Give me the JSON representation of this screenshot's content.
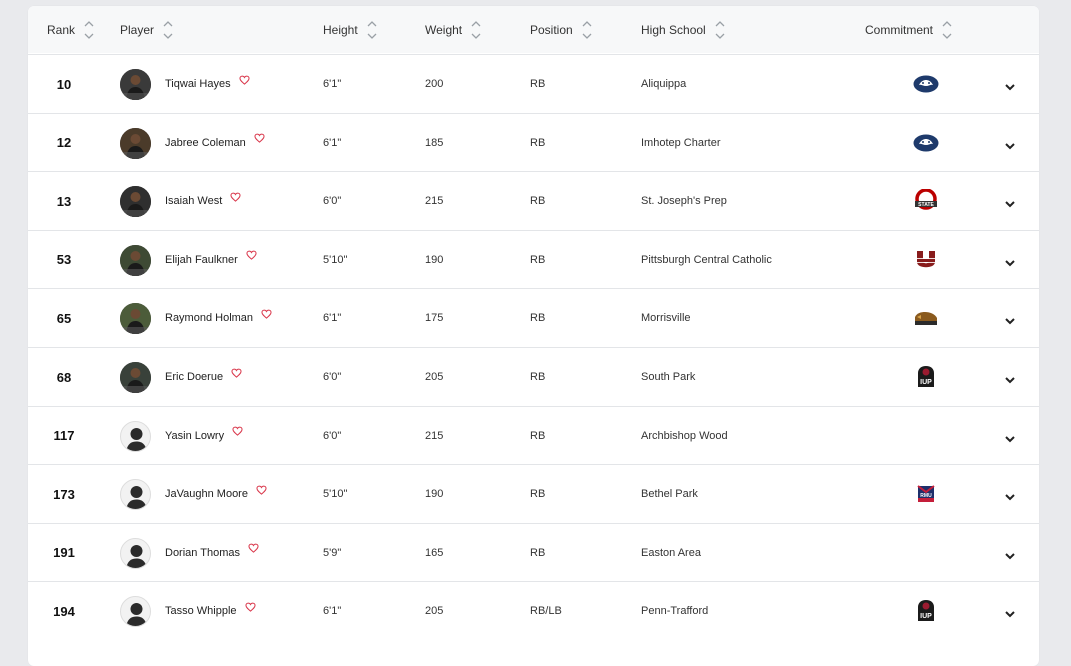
{
  "columns": {
    "rank": "Rank",
    "player": "Player",
    "height": "Height",
    "weight": "Weight",
    "position": "Position",
    "high_school": "High School",
    "commitment": "Commitment"
  },
  "rows": [
    {
      "rank": "10",
      "name": "Tiqwai Hayes",
      "height": "6'1\"",
      "weight": "200",
      "position": "RB",
      "school": "Aliquippa",
      "commit": "penn-state-logo",
      "has_photo": true
    },
    {
      "rank": "12",
      "name": "Jabree Coleman",
      "height": "6'1\"",
      "weight": "185",
      "position": "RB",
      "school": "Imhotep Charter",
      "commit": "penn-state-logo",
      "has_photo": true
    },
    {
      "rank": "13",
      "name": "Isaiah West",
      "height": "6'0\"",
      "weight": "215",
      "position": "RB",
      "school": "St. Joseph's Prep",
      "commit": "ohio-state-logo",
      "has_photo": true
    },
    {
      "rank": "53",
      "name": "Elijah Faulkner",
      "height": "5'10\"",
      "weight": "190",
      "position": "RB",
      "school": "Pittsburgh Central Catholic",
      "commit": "umass-logo",
      "has_photo": true
    },
    {
      "rank": "65",
      "name": "Raymond Holman",
      "height": "6'1\"",
      "weight": "175",
      "position": "RB",
      "school": "Morrisville",
      "commit": "bison-logo",
      "has_photo": true
    },
    {
      "rank": "68",
      "name": "Eric Doerue",
      "height": "6'0\"",
      "weight": "205",
      "position": "RB",
      "school": "South Park",
      "commit": "iup-logo",
      "has_photo": true
    },
    {
      "rank": "117",
      "name": "Yasin Lowry",
      "height": "6'0\"",
      "weight": "215",
      "position": "RB",
      "school": "Archbishop Wood",
      "commit": "",
      "has_photo": false
    },
    {
      "rank": "173",
      "name": "JaVaughn Moore",
      "height": "5'10\"",
      "weight": "190",
      "position": "RB",
      "school": "Bethel Park",
      "commit": "robert-morris-logo",
      "has_photo": false
    },
    {
      "rank": "191",
      "name": "Dorian Thomas",
      "height": "5'9\"",
      "weight": "165",
      "position": "RB",
      "school": "Easton Area",
      "commit": "",
      "has_photo": false
    },
    {
      "rank": "194",
      "name": "Tasso Whipple",
      "height": "6'1\"",
      "weight": "205",
      "position": "RB/LB",
      "school": "Penn-Trafford",
      "commit": "iup-logo",
      "has_photo": false
    }
  ],
  "colors": {
    "heart": "#d9364a",
    "penn_state": "#1e3a6b",
    "ohio_state": "#bb0000",
    "umass": "#881c1c",
    "iup": "#9b1b30"
  }
}
